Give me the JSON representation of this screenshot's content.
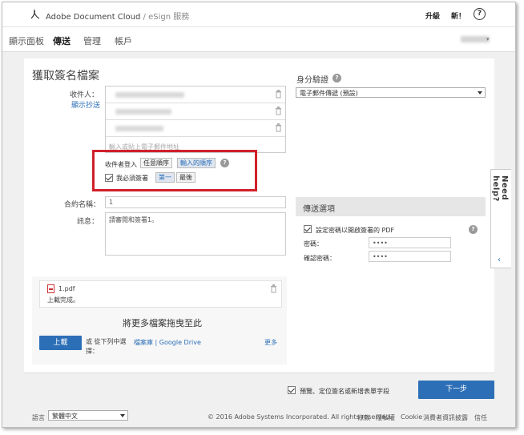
{
  "app": {
    "brand": "Adobe Document Cloud",
    "service": " / eSign 服務",
    "upgrade": "升級",
    "new": "新！",
    "help": "?"
  },
  "nav": {
    "tabs": [
      "顯示面板",
      "傳送",
      "管理",
      "帳戶"
    ],
    "active": 1
  },
  "form": {
    "title": "獲取簽名檔案",
    "recipients_label": "收件人：",
    "show_cc": "顯示抄送",
    "recipient_placeholder": "輸入或貼上電子郵件地址",
    "signing_order_label": "收件者登入",
    "order_any": "任意順序",
    "order_entered": "輸入的順序",
    "must_sign": "我必須簽署",
    "first": "第一",
    "last": "最後",
    "agreement_name_label": "合約名稱：",
    "agreement_name": "1",
    "message_label": "訊息：",
    "message": "請審閱和簽署1。"
  },
  "upload": {
    "file_name": "1.pdf",
    "status": "上載完成。",
    "drop_text": "將更多檔案拖曳至此",
    "upload_button": "上載",
    "or_select": "或 從下列中選擇：",
    "library_link": "檔案庫 | Google Drive",
    "more": "更多"
  },
  "auth": {
    "label": "身分驗證",
    "method": "電子郵件傳遞 (預設)"
  },
  "options": {
    "title": "傳送選項",
    "protect_pdf": "設定密碼以開啟簽署的 PDF",
    "password_label": "密碼：",
    "password_value": "••••",
    "confirm_label": "確認密碼：",
    "confirm_value": "••••"
  },
  "need_help": "Need help?",
  "actions": {
    "preview": "預覽、定位簽名或新增表單字段",
    "next": "下一步"
  },
  "footer": {
    "language_label": "語言",
    "language": "繁體中文",
    "copyright": "© 2016 Adobe Systems Incorporated. All rights reserved.",
    "links": [
      "條款",
      "隱私權",
      "Cookie",
      "消費者資訊披露",
      "信任"
    ]
  }
}
